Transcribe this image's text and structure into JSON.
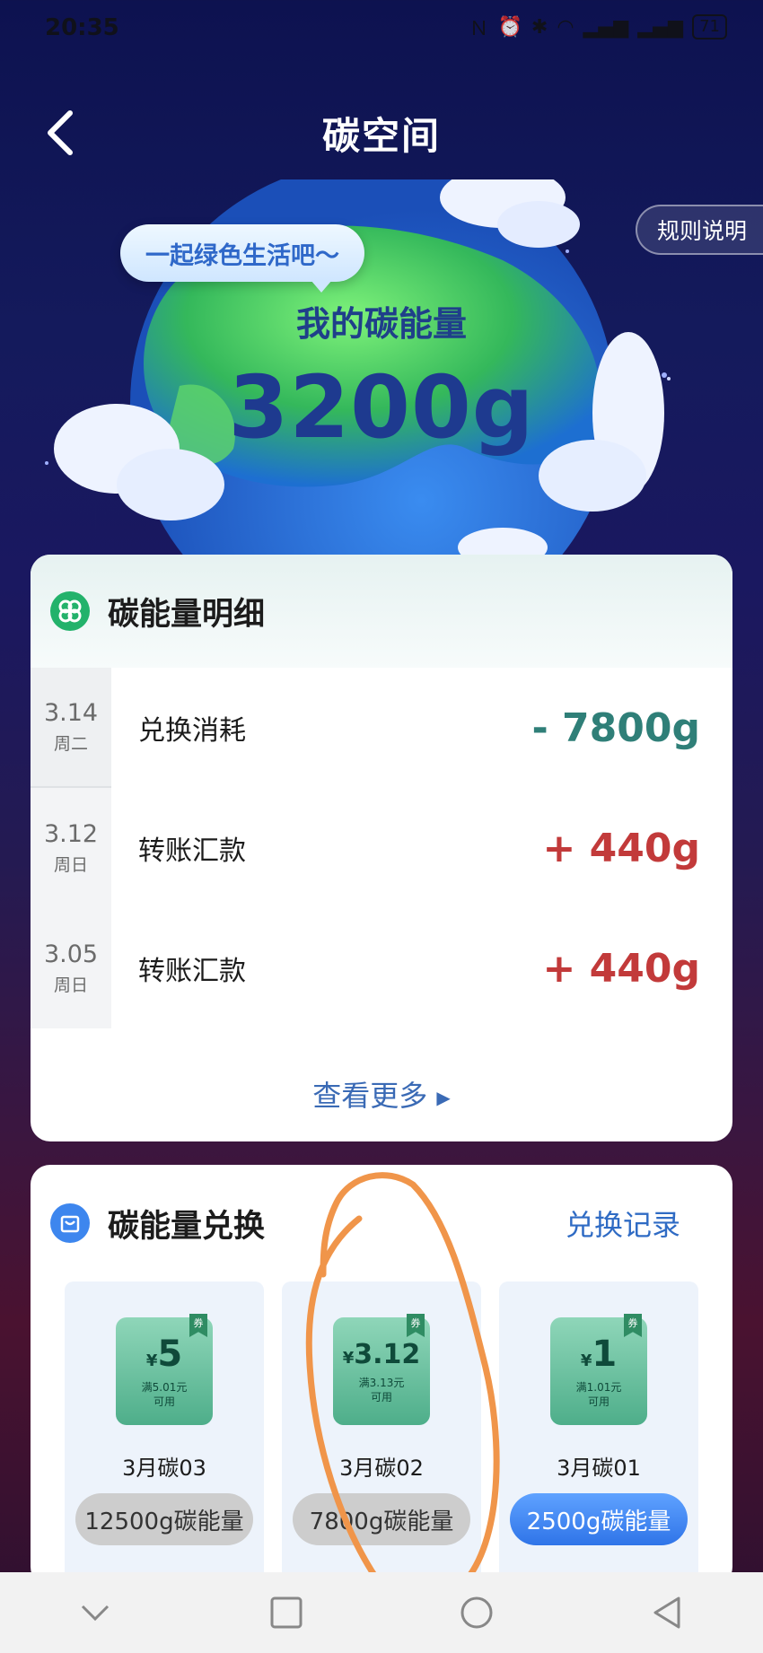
{
  "status_bar": {
    "time": "20:35",
    "battery": "71"
  },
  "header": {
    "title": "碳空间",
    "rules_label": "规则说明"
  },
  "hero": {
    "speech": "一起绿色生活吧～",
    "energy_label": "我的碳能量",
    "energy_value": "3200g"
  },
  "detail": {
    "title": "碳能量明细",
    "rows": [
      {
        "date": "3.14",
        "weekday": "周二",
        "label": "兑换消耗",
        "amount": "- 7800g",
        "sign": "neg"
      },
      {
        "date": "3.12",
        "weekday": "周日",
        "label": "转账汇款",
        "amount": "+ 440g",
        "sign": "pos"
      },
      {
        "date": "3.05",
        "weekday": "周日",
        "label": "转账汇款",
        "amount": "+ 440g",
        "sign": "pos"
      }
    ],
    "more_label": "查看更多"
  },
  "exchange": {
    "title": "碳能量兑换",
    "record_label": "兑换记录",
    "coupons": [
      {
        "currency": "¥",
        "value": "5",
        "condition": "满5.01元",
        "usable": "可用",
        "tag": "券",
        "name": "3月碳03",
        "button": "12500g碳能量",
        "enabled": false
      },
      {
        "currency": "¥",
        "value": "3.12",
        "condition": "满3.13元",
        "usable": "可用",
        "tag": "券",
        "name": "3月碳02",
        "button": "7800g碳能量",
        "enabled": false
      },
      {
        "currency": "¥",
        "value": "1",
        "condition": "满1.01元",
        "usable": "可用",
        "tag": "券",
        "name": "3月碳01",
        "button": "2500g碳能量",
        "enabled": true
      }
    ]
  },
  "colors": {
    "accent_blue": "#2f74e8",
    "negative_amount": "#2f7f78",
    "positive_amount": "#c23a3a",
    "annotation": "#f0954a"
  }
}
